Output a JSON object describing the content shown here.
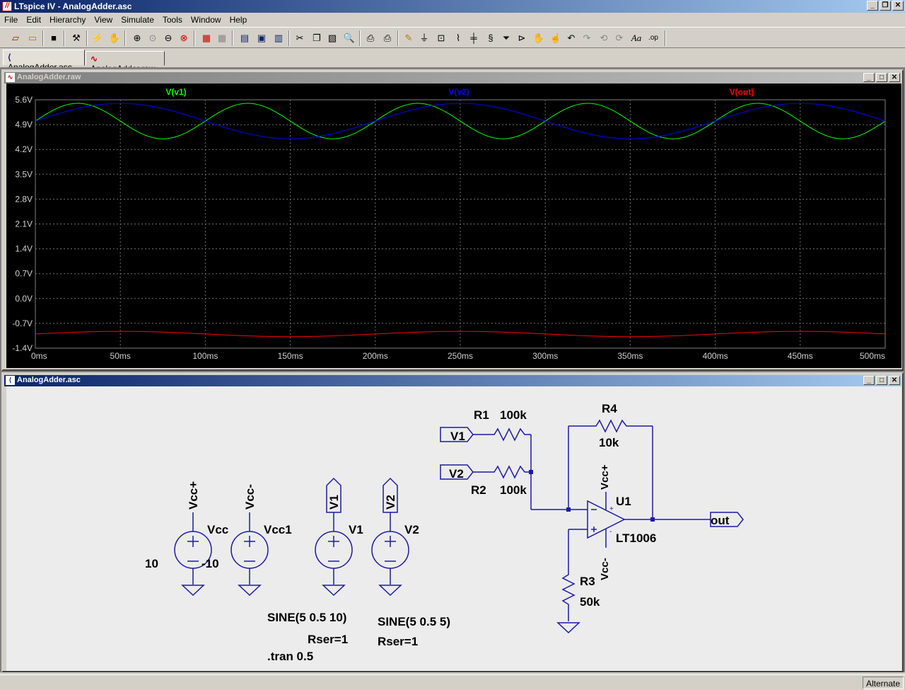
{
  "window": {
    "title": "LTspice IV - AnalogAdder.asc"
  },
  "menu": [
    "File",
    "Edit",
    "Hierarchy",
    "View",
    "Simulate",
    "Tools",
    "Window",
    "Help"
  ],
  "tabs": [
    {
      "label": "AnalogAdder.asc",
      "active": true
    },
    {
      "label": "AnalogAdder.raw",
      "active": false
    }
  ],
  "waveform_window": {
    "title": "AnalogAdder.raw"
  },
  "schematic_window": {
    "title": "AnalogAdder.asc"
  },
  "status": {
    "mode": "Alternate"
  },
  "colors": {
    "v1": "#00ff00",
    "v2": "#0000ff",
    "out": "#ff0000",
    "wire": "#0000c8"
  },
  "chart_data": {
    "type": "line",
    "xlabel": "",
    "ylabel": "",
    "xlim": [
      0,
      500
    ],
    "ylim": [
      -1.4,
      5.6
    ],
    "x_ticks": [
      "0ms",
      "50ms",
      "100ms",
      "150ms",
      "200ms",
      "250ms",
      "300ms",
      "350ms",
      "400ms",
      "450ms",
      "500ms"
    ],
    "y_ticks": [
      "5.6V",
      "4.9V",
      "4.2V",
      "3.5V",
      "2.8V",
      "2.1V",
      "1.4V",
      "0.7V",
      "0.0V",
      "-0.7V",
      "-1.4V"
    ],
    "grid": true,
    "series": [
      {
        "name": "V(v1)",
        "color": "#00ff00",
        "offset": 5,
        "amplitude": 0.5,
        "freq_hz": 10
      },
      {
        "name": "V(v2)",
        "color": "#0000ff",
        "offset": 5,
        "amplitude": 0.5,
        "freq_hz": 5
      },
      {
        "name": "V(out)",
        "color": "#ff0000",
        "offset": -1,
        "amplitude": 0.075,
        "freq_hz": 5
      }
    ]
  },
  "schematic": {
    "labels": {
      "r1_name": "R1",
      "r1_value": "100k",
      "r2_name": "R2",
      "r2_value": "100k",
      "r3_name": "R3",
      "r3_value": "50k",
      "r4_name": "R4",
      "r4_value": "10k",
      "u1_name": "U1",
      "u1_model": "LT1006",
      "vcc_name": "Vcc",
      "vcc_value": "10",
      "vcc1_name": "Vcc1",
      "vcc1_value": "-10",
      "v1_name": "V1",
      "v2_name": "V2",
      "v1_func": "SINE(5 0.5 10)",
      "v1_rser": "Rser=1",
      "v2_func": "SINE(5 0.5 5)",
      "v2_rser": "Rser=1",
      "tran": ".tran 0.5",
      "flag_v1_in": "V1",
      "flag_v2_in": "V2",
      "flag_vccp": "Vcc+",
      "flag_vccm": "Vcc-",
      "flag_v1": "V1",
      "flag_v2": "V2",
      "flag_out": "out",
      "opamp_vccp": "Vcc+",
      "opamp_vccm": "Vcc-"
    }
  }
}
